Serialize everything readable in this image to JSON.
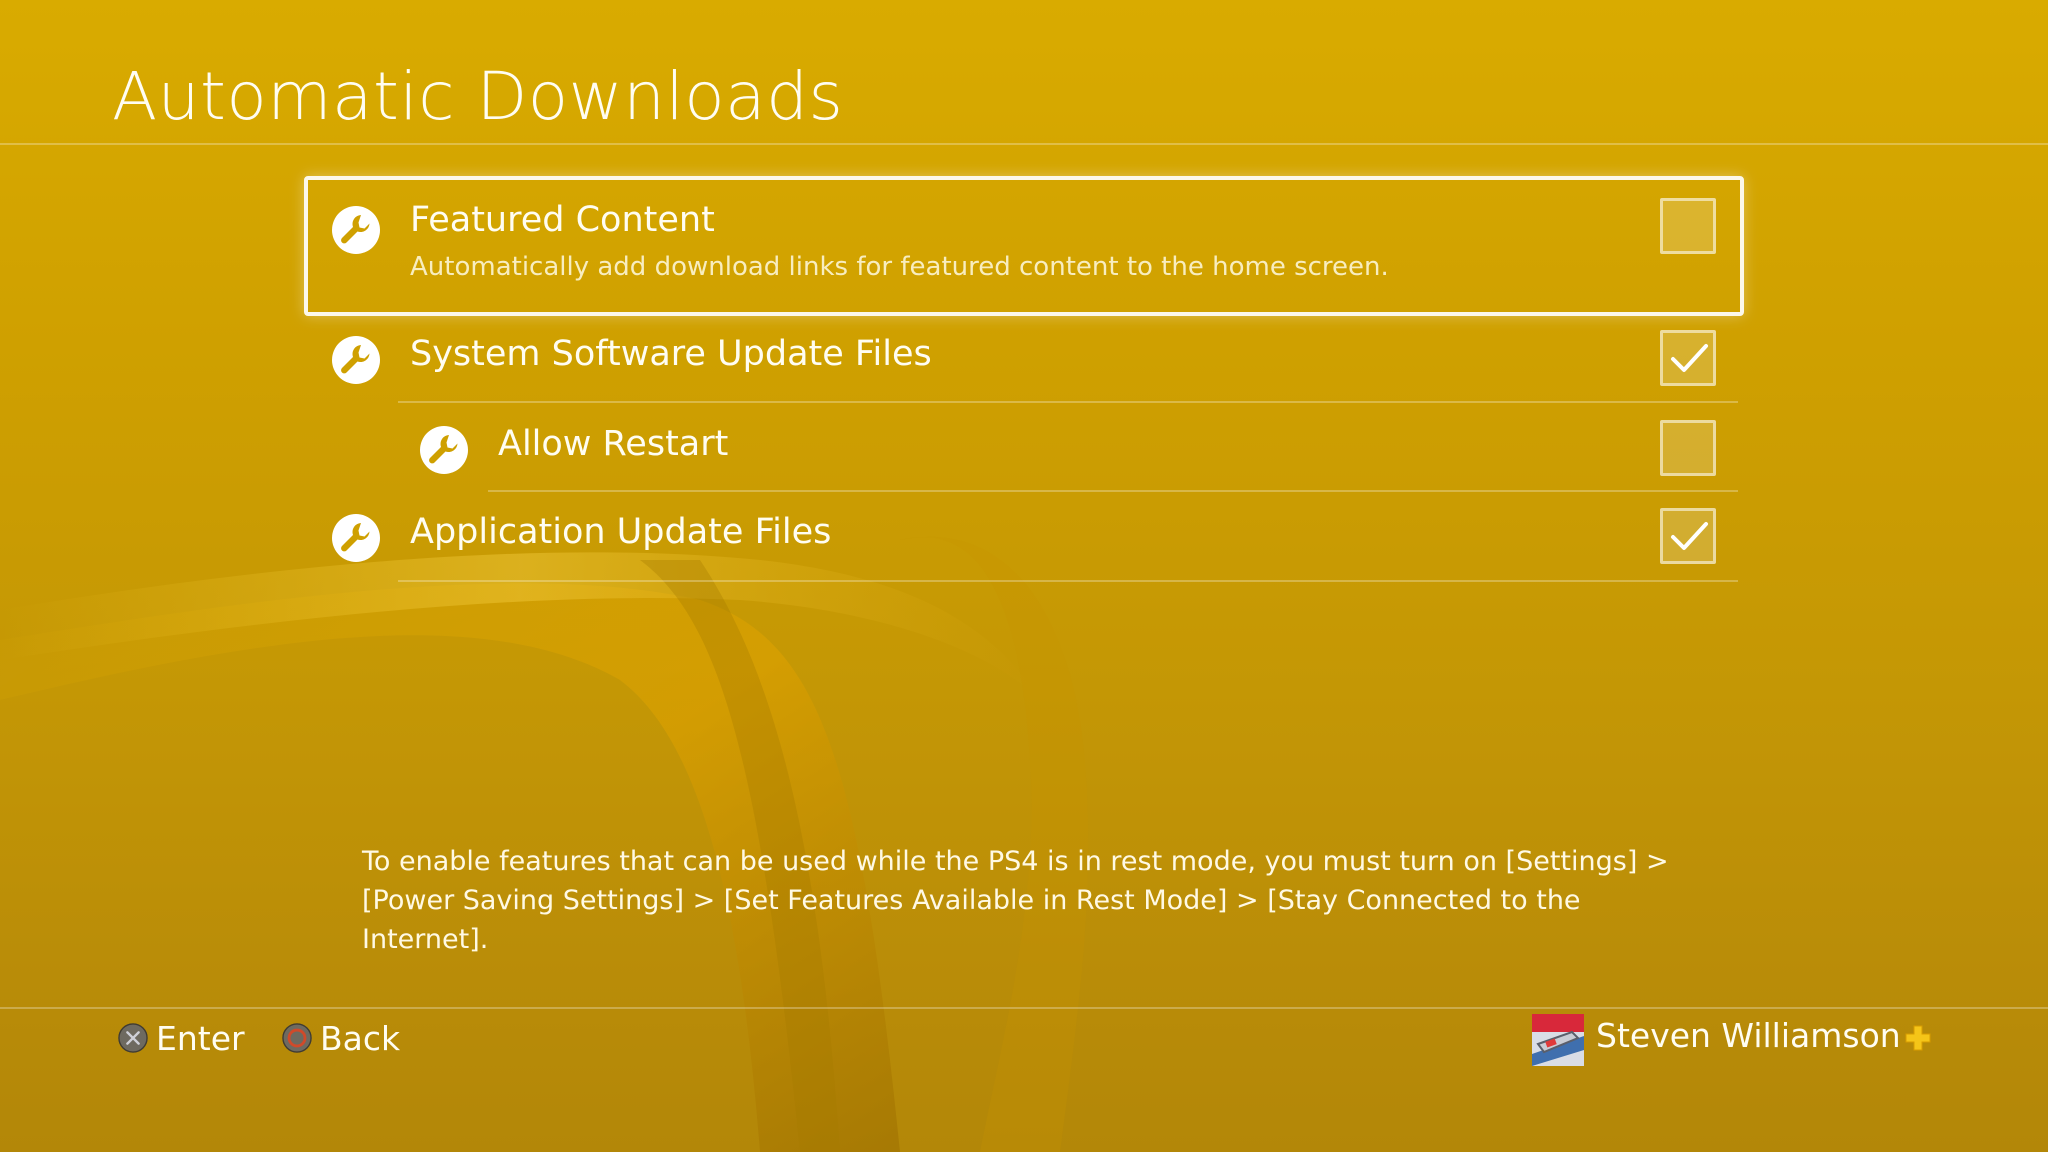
{
  "page": {
    "title": "Automatic Downloads"
  },
  "settings": [
    {
      "label": "Featured Content",
      "description": "Automatically add download links for featured content to the home screen.",
      "checked": false,
      "focused": true,
      "icon": "wrench-icon"
    },
    {
      "label": "System Software Update Files",
      "checked": true,
      "icon": "wrench-icon"
    },
    {
      "label": "Allow Restart",
      "checked": false,
      "icon": "wrench-icon"
    },
    {
      "label": "Application Update Files",
      "checked": true,
      "icon": "wrench-icon"
    }
  ],
  "info": {
    "text": "To enable features that can be used while the PS4 is in rest mode, you must turn on [Settings] > [Power Saving Settings] > [Set Features Available in Rest Mode] > [Stay Connected to the Internet]."
  },
  "footer": {
    "enter_label": "Enter",
    "enter_icon": "cross-button-icon",
    "back_label": "Back",
    "back_icon": "circle-button-icon",
    "user_name": "Steven Williamson",
    "plus_icon": "playstation-plus-icon"
  },
  "colors": {
    "background": "#cfa000",
    "plus": "#f5c518",
    "circle_button": "#d04a2a"
  }
}
